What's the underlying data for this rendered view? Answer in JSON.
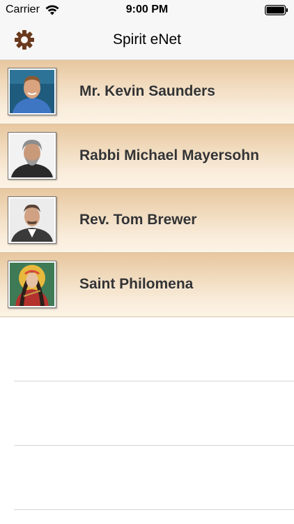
{
  "status_bar": {
    "carrier": "Carrier",
    "time": "9:00 PM"
  },
  "nav_bar": {
    "title": "Spirit eNet",
    "settings_icon": "gear-icon"
  },
  "contacts": [
    {
      "name": "Mr. Kevin Saunders"
    },
    {
      "name": "Rabbi Michael Mayersohn"
    },
    {
      "name": "Rev. Tom Brewer"
    },
    {
      "name": "Saint Philomena"
    }
  ],
  "colors": {
    "row_gradient_top": "#e7c79f",
    "row_gradient_bottom": "#fcf3e6",
    "label_text": "#333333",
    "gear": "#6b3a1e"
  }
}
